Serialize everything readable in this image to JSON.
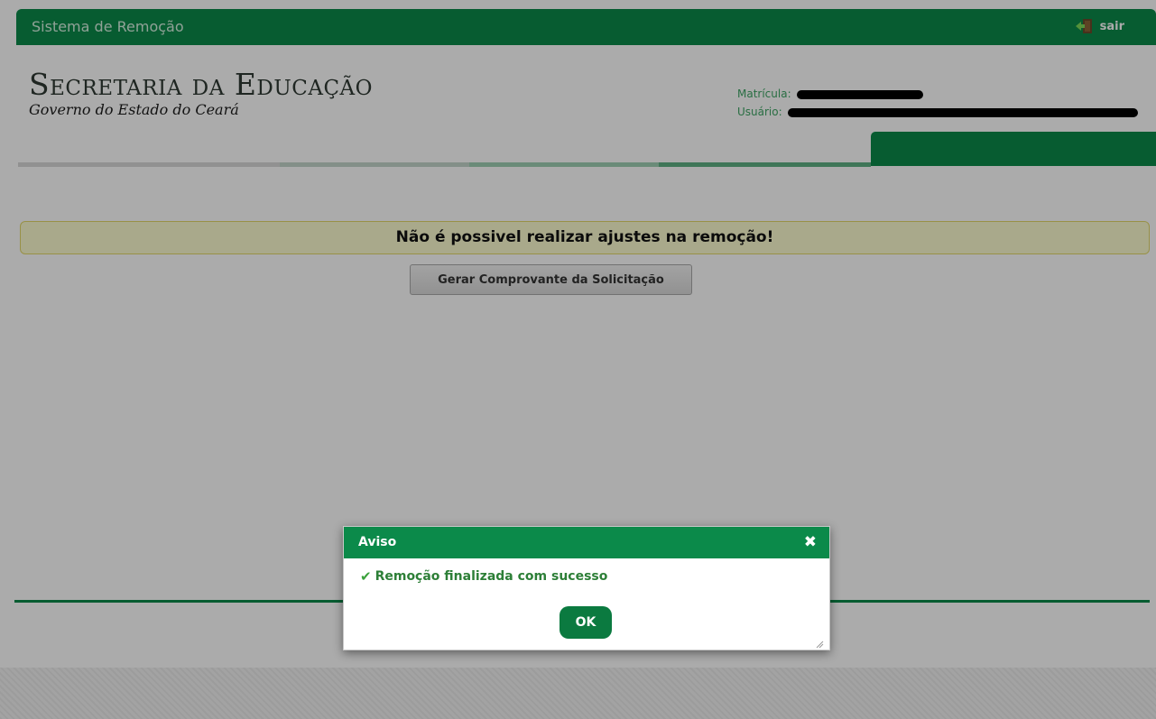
{
  "topbar": {
    "app_title": "Sistema de Remoção",
    "logout_label": "sair"
  },
  "header": {
    "brand_main": "Secretaria da Educação",
    "brand_sub": "Governo do Estado do Ceará",
    "matricula_label": "Matrícula:",
    "usuario_label": "Usuário:"
  },
  "main": {
    "warning_text": "Não é possivel realizar ajustes na remoção!",
    "receipt_button_label": "Gerar Comprovante da Solicitação"
  },
  "dialog": {
    "title": "Aviso",
    "message": "Remoção finalizada com sucesso",
    "ok_label": "OK",
    "close_icon": "close-icon",
    "message_icon": "check-icon"
  },
  "colors": {
    "brand_green": "#0b8a4a",
    "warning_bg": "#fdfdcf",
    "success_text": "#2d7f37",
    "overlay": "rgba(0,0,0,0.33)"
  }
}
